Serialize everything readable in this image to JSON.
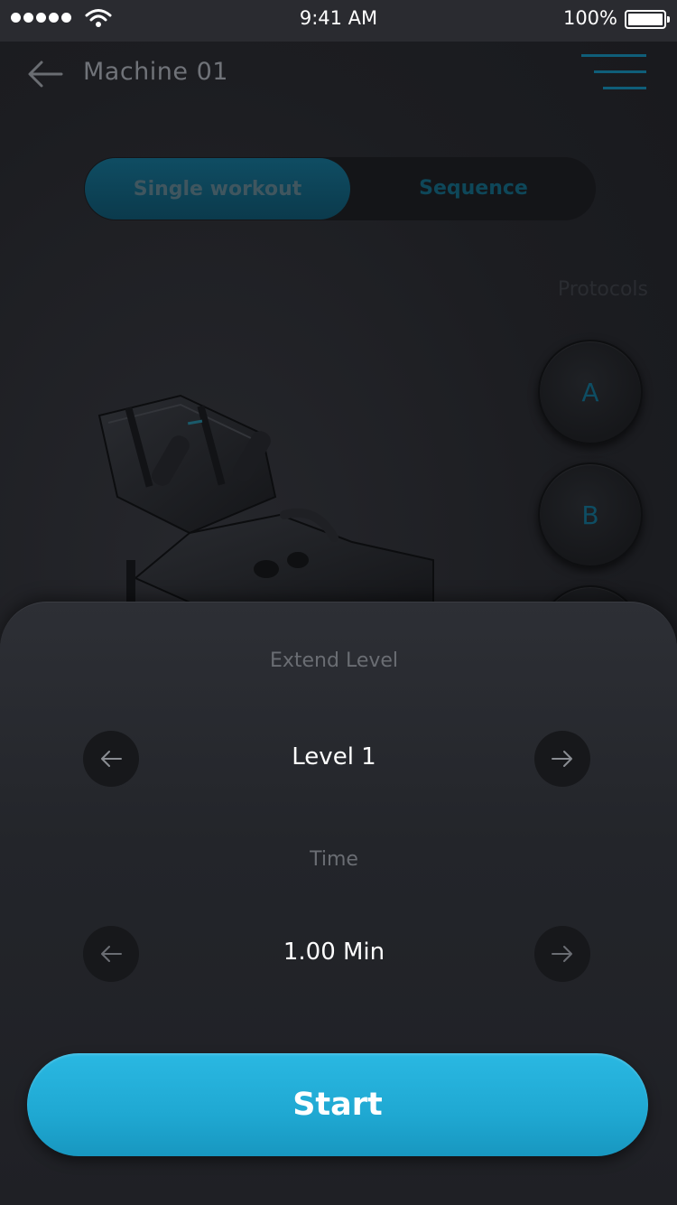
{
  "status_bar": {
    "time": "9:41 AM",
    "battery": "100%"
  },
  "header": {
    "title": "Machine 01"
  },
  "mode_tabs": {
    "active": "Single workout",
    "inactive": "Sequence"
  },
  "protocols": {
    "label": "Protocols",
    "items": [
      "A",
      "B"
    ]
  },
  "settings": {
    "extend_level": {
      "label": "Extend Level",
      "value": "Level 1"
    },
    "time": {
      "label": "Time",
      "value": "1.00 Min"
    }
  },
  "start_button": {
    "label": "Start"
  },
  "colors": {
    "accent": "#22aed8",
    "background": "#1a1b1f",
    "sheet": "#2a2c31"
  },
  "icons": [
    "signal-icon",
    "wifi-icon",
    "battery-icon",
    "back-arrow-icon",
    "menu-icon",
    "arrow-left-icon",
    "arrow-right-icon"
  ]
}
